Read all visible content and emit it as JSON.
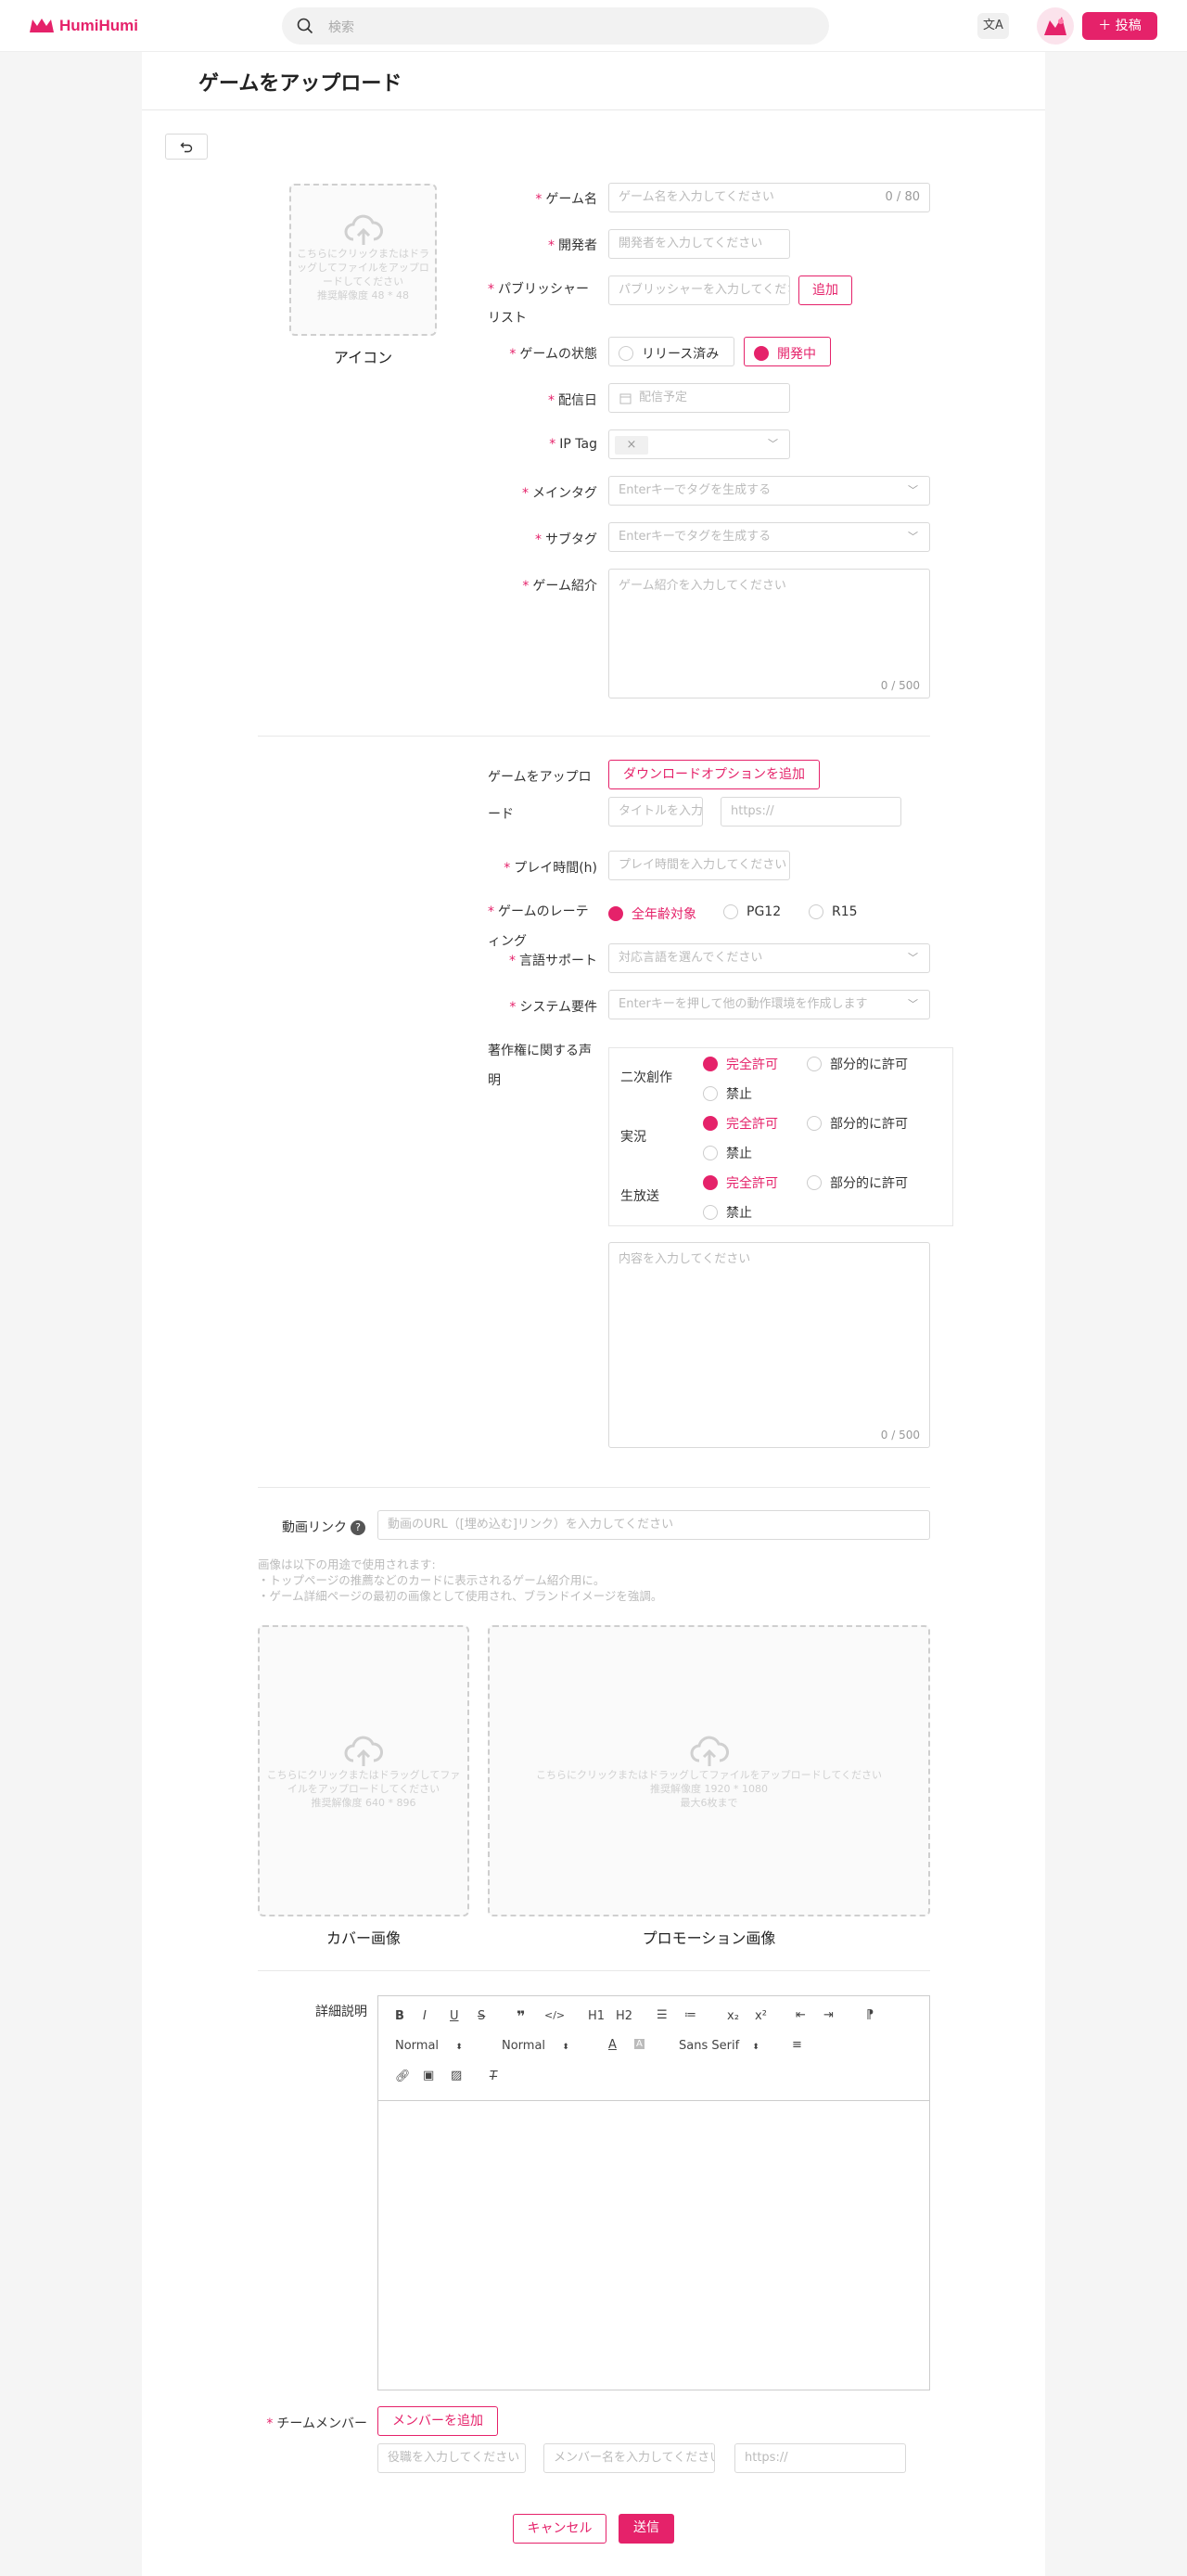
{
  "header": {
    "logo_text": "HumiHumi",
    "search_placeholder": "検索",
    "translate_label": "文A",
    "post_label": "＋ 投稿"
  },
  "page": {
    "title": "ゲームをアップロード"
  },
  "icon_upload": {
    "hint1": "こちらにクリックまたはドラッグしてファイルをアップロードしてください",
    "hint2": "推奨解像度 48 * 48",
    "caption": "アイコン"
  },
  "form": {
    "game_name": {
      "label": "ゲーム名",
      "placeholder": "ゲーム名を入力してください",
      "count": "0 / 80"
    },
    "developer": {
      "label": "開発者",
      "placeholder": "開発者を入力してください"
    },
    "publisher": {
      "label": "パブリッシャーリスト",
      "placeholder": "パブリッシャーを入力してください",
      "add": "追加"
    },
    "status": {
      "label": "ゲームの状態",
      "options": [
        "リリース済み",
        "開発中"
      ]
    },
    "release_date": {
      "label": "配信日",
      "placeholder": "配信予定"
    },
    "ip_tag": {
      "label": "IP Tag",
      "tag_close": "×"
    },
    "main_tag": {
      "label": "メインタグ",
      "placeholder": "Enterキーでタグを生成する"
    },
    "sub_tag": {
      "label": "サブタグ",
      "placeholder": "Enterキーでタグを生成する"
    },
    "intro": {
      "label": "ゲーム紹介",
      "placeholder": "ゲーム紹介を入力してください",
      "count": "0 / 500"
    }
  },
  "download": {
    "label": "ゲームをアップロード",
    "add_button": "ダウンロードオプションを追加",
    "title_placeholder": "タイトルを入力してください",
    "url_placeholder": "https://"
  },
  "play_time": {
    "label": "プレイ時間(h)",
    "placeholder": "プレイ時間を入力してください"
  },
  "rating": {
    "label": "ゲームのレーティング",
    "options": [
      "全年齢対象",
      "PG12",
      "R15"
    ]
  },
  "language": {
    "label": "言語サポート",
    "placeholder": "対応言語を選んでください"
  },
  "system": {
    "label": "システム要件",
    "placeholder": "Enterキーを押して他の動作環境を作成します"
  },
  "copyright": {
    "label": "著作権に関する声明",
    "rows": [
      {
        "label": "二次創作",
        "options": [
          "完全許可",
          "部分的に許可",
          "禁止"
        ]
      },
      {
        "label": "実況",
        "options": [
          "完全許可",
          "部分的に許可",
          "禁止"
        ]
      },
      {
        "label": "生放送",
        "options": [
          "完全許可",
          "部分的に許可",
          "禁止"
        ]
      }
    ],
    "textarea_placeholder": "内容を入力してください",
    "count": "0 / 500"
  },
  "video": {
    "label": "動画リンク",
    "help": "?",
    "placeholder": "動画のURL（[埋め込む]リンク）を入力してください"
  },
  "image_note": {
    "line1": "画像は以下の用途で使用されます:",
    "line2": "・トップページの推薦などのカードに表示されるゲーム紹介用に。",
    "line3": "・ゲーム詳細ページの最初の画像として使用され、ブランドイメージを強調。"
  },
  "cover": {
    "hint1": "こちらにクリックまたはドラッグしてファイルをアップロードしてください",
    "hint2": "推奨解像度 640 * 896",
    "caption": "カバー画像"
  },
  "promo": {
    "hint1": "こちらにクリックまたはドラッグしてファイルをアップロードしてください",
    "hint2": "推奨解像度 1920 * 1080",
    "hint3": "最大6枚まで",
    "caption": "プロモーション画像"
  },
  "detail": {
    "label": "詳細説明",
    "toolbar": {
      "header1": "H1",
      "header2": "H2",
      "size": "Normal",
      "heading": "Normal",
      "font": "Sans Serif",
      "sub": "x₂",
      "sup": "x²"
    }
  },
  "team": {
    "label": "チームメンバー",
    "add_button": "メンバーを追加",
    "role_placeholder": "役職を入力してください",
    "name_placeholder": "メンバー名を入力してください",
    "url_placeholder": "https://"
  },
  "actions": {
    "cancel": "キャンセル",
    "submit": "送信"
  },
  "colors": {
    "accent": "#e5226a",
    "border": "#d9d9d9"
  }
}
